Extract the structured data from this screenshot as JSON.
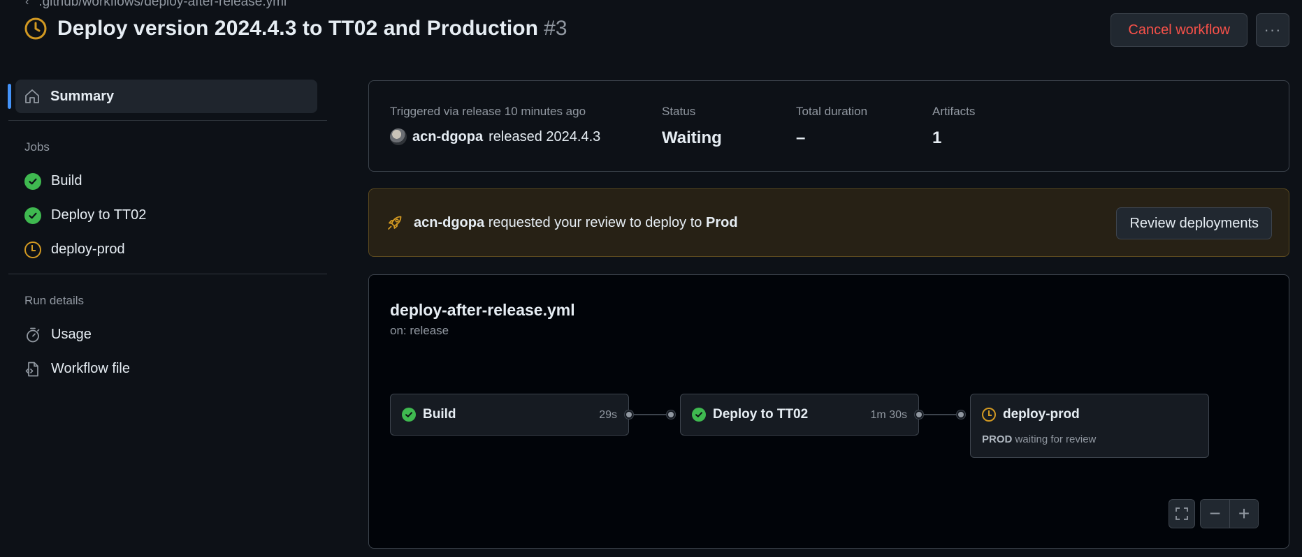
{
  "header": {
    "breadcrumb": ".github/workflows/deploy-after-release.yml",
    "title": "Deploy version 2024.4.3 to TT02 and Production",
    "run_number": "#3",
    "cancel_label": "Cancel workflow",
    "more_label": "···"
  },
  "sidebar": {
    "summary_label": "Summary",
    "jobs_heading": "Jobs",
    "jobs": [
      {
        "label": "Build",
        "status": "success"
      },
      {
        "label": "Deploy to TT02",
        "status": "success"
      },
      {
        "label": "deploy-prod",
        "status": "waiting"
      }
    ],
    "run_details_heading": "Run details",
    "run_details": [
      {
        "label": "Usage",
        "icon": "stopwatch-icon"
      },
      {
        "label": "Workflow file",
        "icon": "file-code-icon"
      }
    ]
  },
  "info": {
    "trigger_label": "Triggered via release 10 minutes ago",
    "actor": "acn-dgopa",
    "trigger_action": "released 2024.4.3",
    "status_label": "Status",
    "status_value": "Waiting",
    "duration_label": "Total duration",
    "duration_value": "–",
    "artifacts_label": "Artifacts",
    "artifacts_value": "1"
  },
  "review": {
    "actor": "acn-dgopa",
    "text": "requested your review to deploy to",
    "environment": "Prod",
    "button_label": "Review deployments"
  },
  "graph": {
    "file_name": "deploy-after-release.yml",
    "trigger": "on: release",
    "nodes": [
      {
        "name": "Build",
        "duration": "29s",
        "status": "success"
      },
      {
        "name": "Deploy to TT02",
        "duration": "1m 30s",
        "status": "success"
      },
      {
        "name": "deploy-prod",
        "env": "PROD",
        "note": "waiting for review",
        "status": "waiting"
      }
    ]
  },
  "colors": {
    "success": "#3fb950",
    "waiting": "#d29922",
    "danger": "#f85149",
    "accent": "#4493f8"
  }
}
